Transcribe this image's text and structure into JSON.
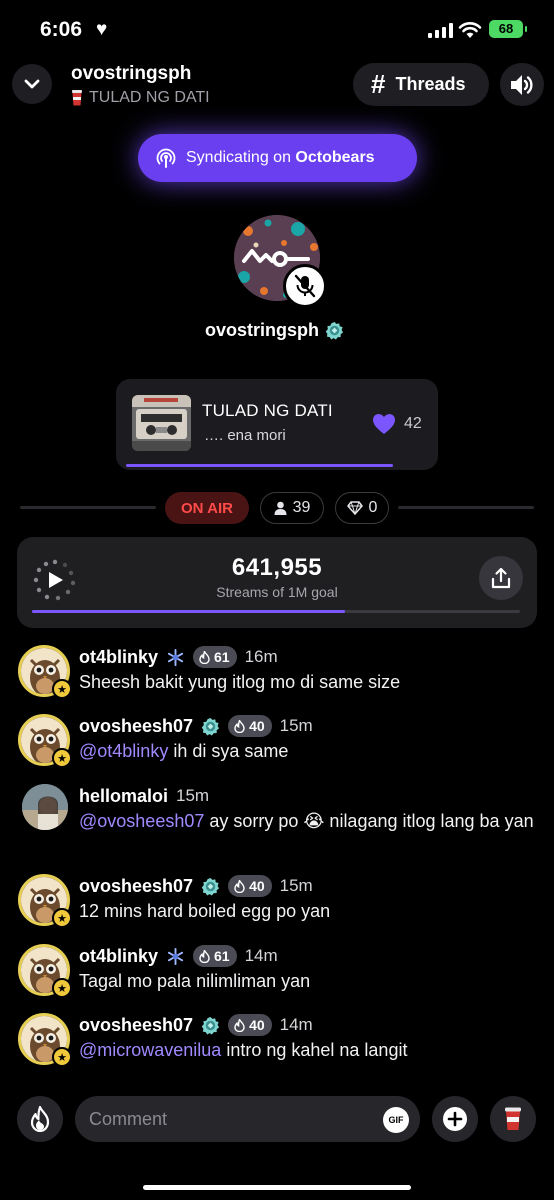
{
  "status_bar": {
    "time": "6:06",
    "battery": "68"
  },
  "header": {
    "title": "ovostringsph",
    "subtitle": "TULAD NG DATI",
    "threads_label": "Threads"
  },
  "syndicate": {
    "prefix": "Syndicating on",
    "brand": "Octobears"
  },
  "host": {
    "name": "ovostringsph"
  },
  "now_playing": {
    "song": "TULAD NG DATI",
    "artist": "…. ena mori",
    "likes": "42",
    "progress": 0.86
  },
  "stats": {
    "on_air": "ON AIR",
    "listeners": "39",
    "gems": "0"
  },
  "streams": {
    "count": "641,955",
    "label": "Streams of 1M goal",
    "progress": 0.642
  },
  "chat": [
    {
      "user": "ot4blinky",
      "level": "61",
      "time": "16m",
      "mention": "",
      "text": "Sheesh bakit yung itlog mo di same size",
      "badge": "blue"
    },
    {
      "user": "ovosheesh07",
      "level": "40",
      "time": "15m",
      "mention": "@ot4blinky",
      "text": " ih di sya same",
      "badge": "teal"
    },
    {
      "user": "hellomaloi",
      "level": "",
      "time": "15m",
      "mention": "@ovosheesh07",
      "text": " ay sorry po 😭 nilagang itlog lang ba yan",
      "badge": ""
    },
    {
      "user": "ovosheesh07",
      "level": "40",
      "time": "15m",
      "mention": "",
      "text": "12 mins hard boiled egg po yan",
      "badge": "teal"
    },
    {
      "user": "ot4blinky",
      "level": "61",
      "time": "14m",
      "mention": "",
      "text": "Tagal mo pala nilimliman yan",
      "badge": "blue"
    },
    {
      "user": "ovosheesh07",
      "level": "40",
      "time": "14m",
      "mention": "@microwavenilua",
      "text": " intro ng kahel na langit",
      "badge": "teal"
    }
  ],
  "composer": {
    "placeholder": "Comment",
    "gif_label": "GIF"
  },
  "colors": {
    "accent": "#7b56ff",
    "on_air": "#ff4a4a",
    "mention": "#a189ff"
  }
}
